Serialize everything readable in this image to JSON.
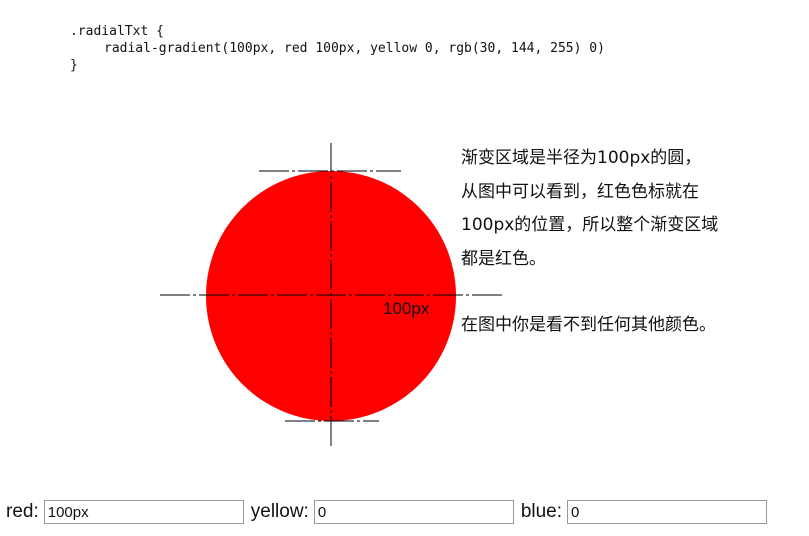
{
  "code": {
    "line1": ".radialTxt {",
    "line2": "radial-gradient(100px, red 100px, yellow 0, rgb(30, 144, 255) 0)",
    "line3": "}"
  },
  "diagram": {
    "radius_label": "100px",
    "fill_color": "#ff0000"
  },
  "explanation": {
    "line1": "渐变区域是半径为100px的圆，",
    "line2": "从图中可以看到，红色色标就在",
    "line3": "100px的位置，所以整个渐变区域",
    "line4": "都是红色。",
    "line5": "在图中你是看不到任何其他颜色。"
  },
  "controls": {
    "red_label": "red:",
    "red_value": "100px",
    "yellow_label": "yellow:",
    "yellow_value": "0",
    "blue_label": "blue:",
    "blue_value": "0"
  }
}
